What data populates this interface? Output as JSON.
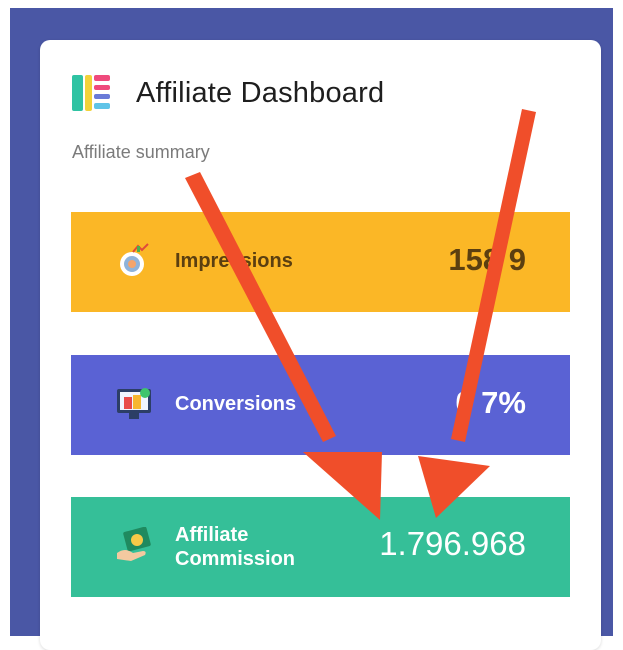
{
  "header": {
    "title": "Affiliate Dashboard",
    "subtitle": "Affiliate summary",
    "icon": "dashboard-grid-icon"
  },
  "stats": [
    {
      "label": "Impressions",
      "value": "158 9",
      "icon": "target-chart-icon",
      "color": "#fbb726"
    },
    {
      "label": "Conversions",
      "value": "0 7%",
      "icon": "shopping-monitor-icon",
      "color": "#5a62d4"
    },
    {
      "label_line1": "Affiliate",
      "label_line2": "Commission",
      "value": "1.796.968",
      "icon": "money-hand-icon",
      "color": "#35bf98"
    }
  ],
  "annotation": {
    "arrow_color": "#f04e2a"
  }
}
